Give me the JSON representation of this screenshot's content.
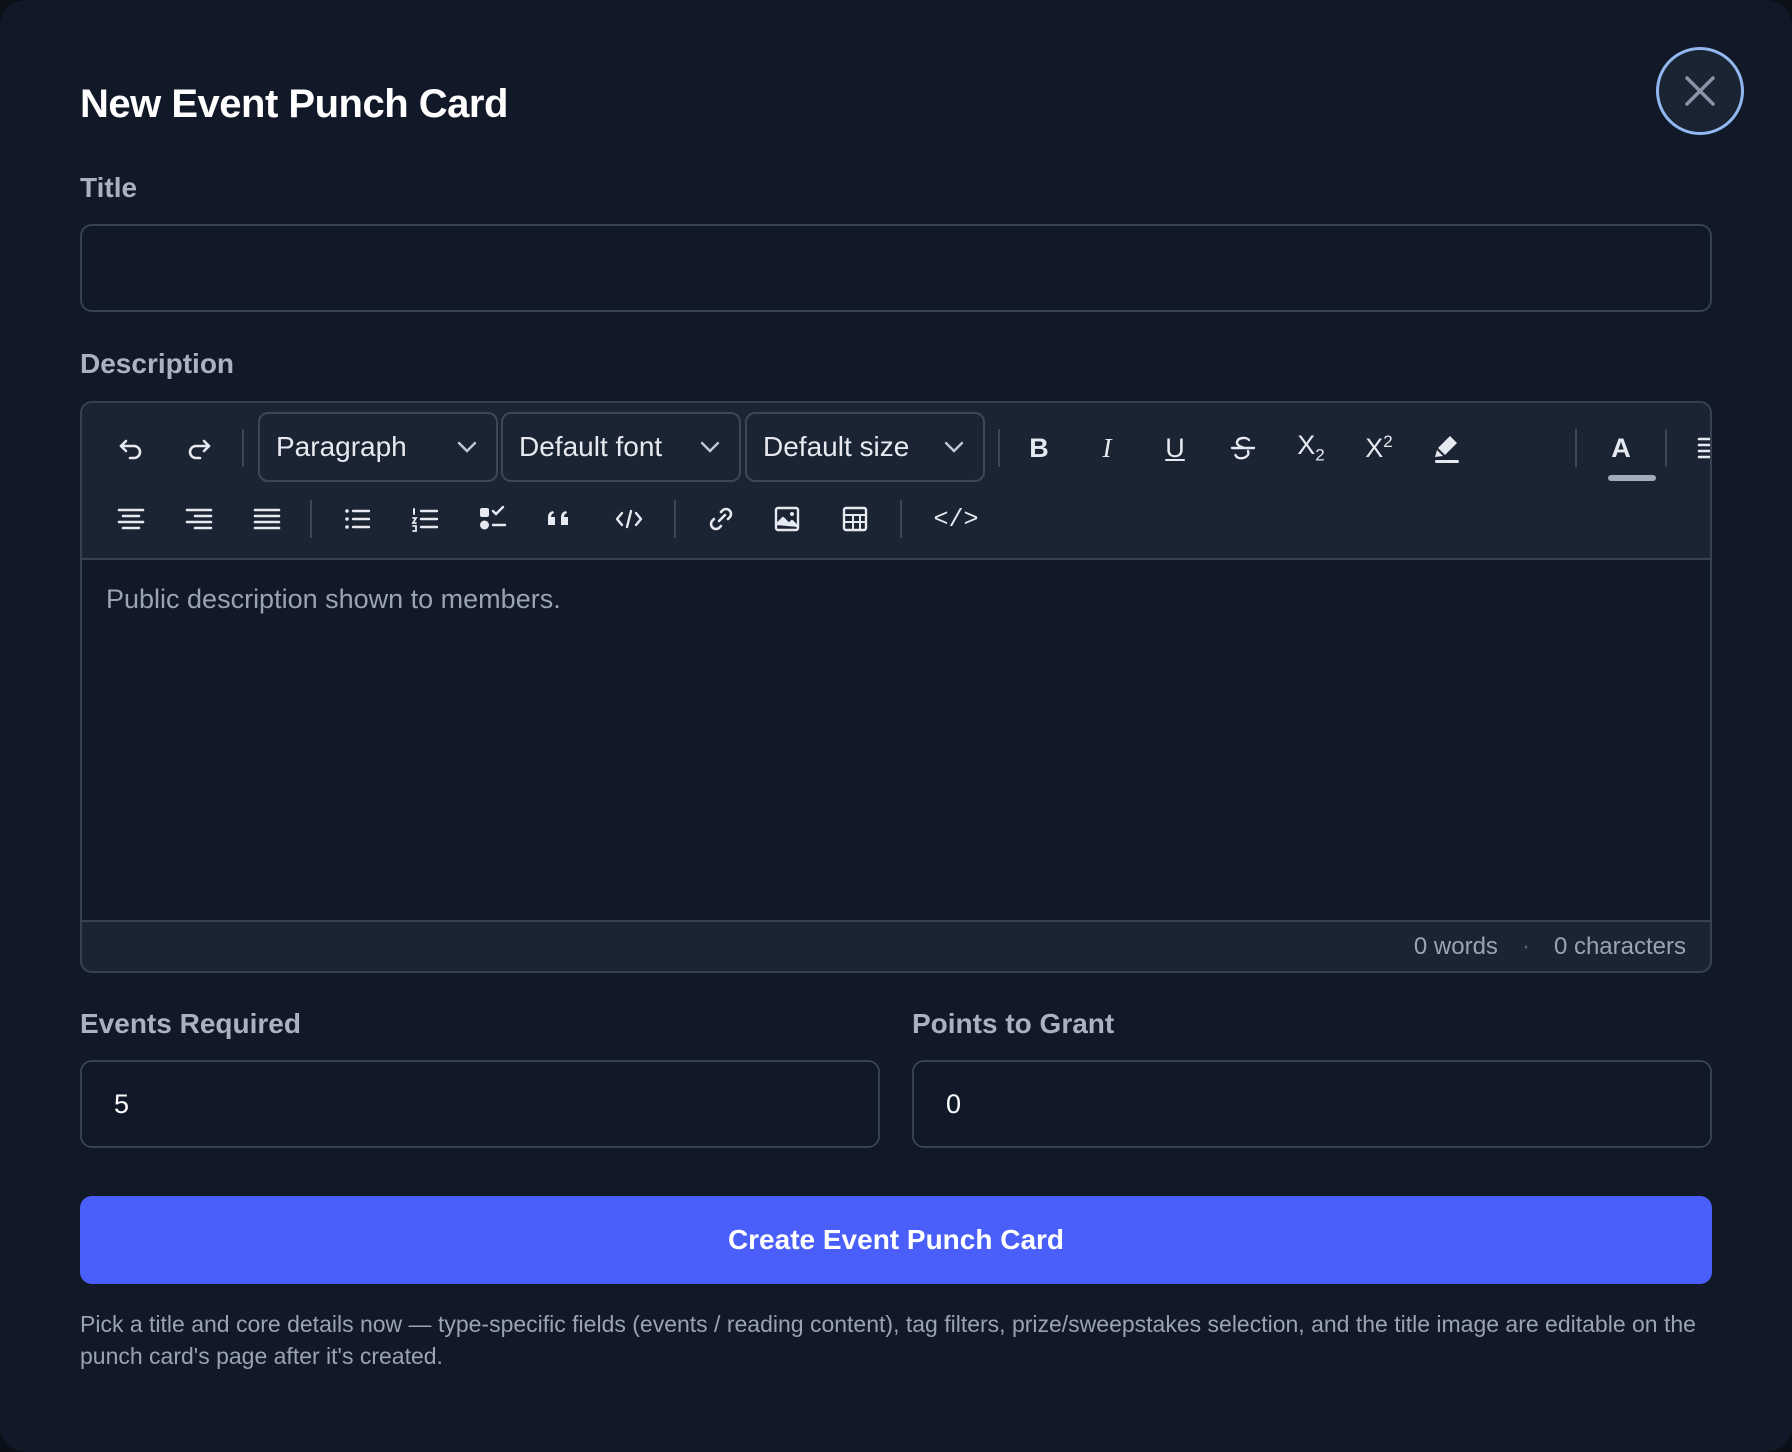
{
  "modal": {
    "title": "New Event Punch Card",
    "close_icon": "close-icon"
  },
  "form": {
    "title_label": "Title",
    "title_value": "",
    "description_label": "Description",
    "events_required_label": "Events Required",
    "events_required_value": "5",
    "points_label": "Points to Grant",
    "points_value": "0",
    "submit_label": "Create Event Punch Card",
    "help_text": "Pick a title and core details now — type-specific fields (events / reading content), tag filters, prize/sweepstakes selection, and the title image are editable on the punch card's page after it's created."
  },
  "editor": {
    "block_format": "Paragraph",
    "font_family": "Default font",
    "font_size": "Default size",
    "placeholder": "Public description shown to members.",
    "word_count": "0 words",
    "char_count": "0 characters",
    "toolbar_icons": [
      "undo-icon",
      "redo-icon",
      "bold-icon",
      "italic-icon",
      "underline-icon",
      "strikethrough-icon",
      "subscript-icon",
      "superscript-icon",
      "highlight-icon",
      "text-color-icon",
      "align-left-icon",
      "align-center-icon",
      "align-right-icon",
      "align-justify-icon",
      "bullet-list-icon",
      "numbered-list-icon",
      "task-list-icon",
      "blockquote-icon",
      "code-icon",
      "link-icon",
      "image-icon",
      "table-icon",
      "html-source-icon"
    ],
    "glyphs": {
      "bold": "B",
      "italic": "I",
      "underline": "U",
      "subscript_base": "X",
      "subscript_sub": "2",
      "superscript_base": "X",
      "superscript_sup": "2",
      "text_color": "A",
      "html_source": "</>"
    }
  },
  "colors": {
    "background": "#111827",
    "toolbar": "#1b2433",
    "border": "#364152",
    "primary": "#4a5ffa",
    "close_ring": "#93b8ef"
  }
}
